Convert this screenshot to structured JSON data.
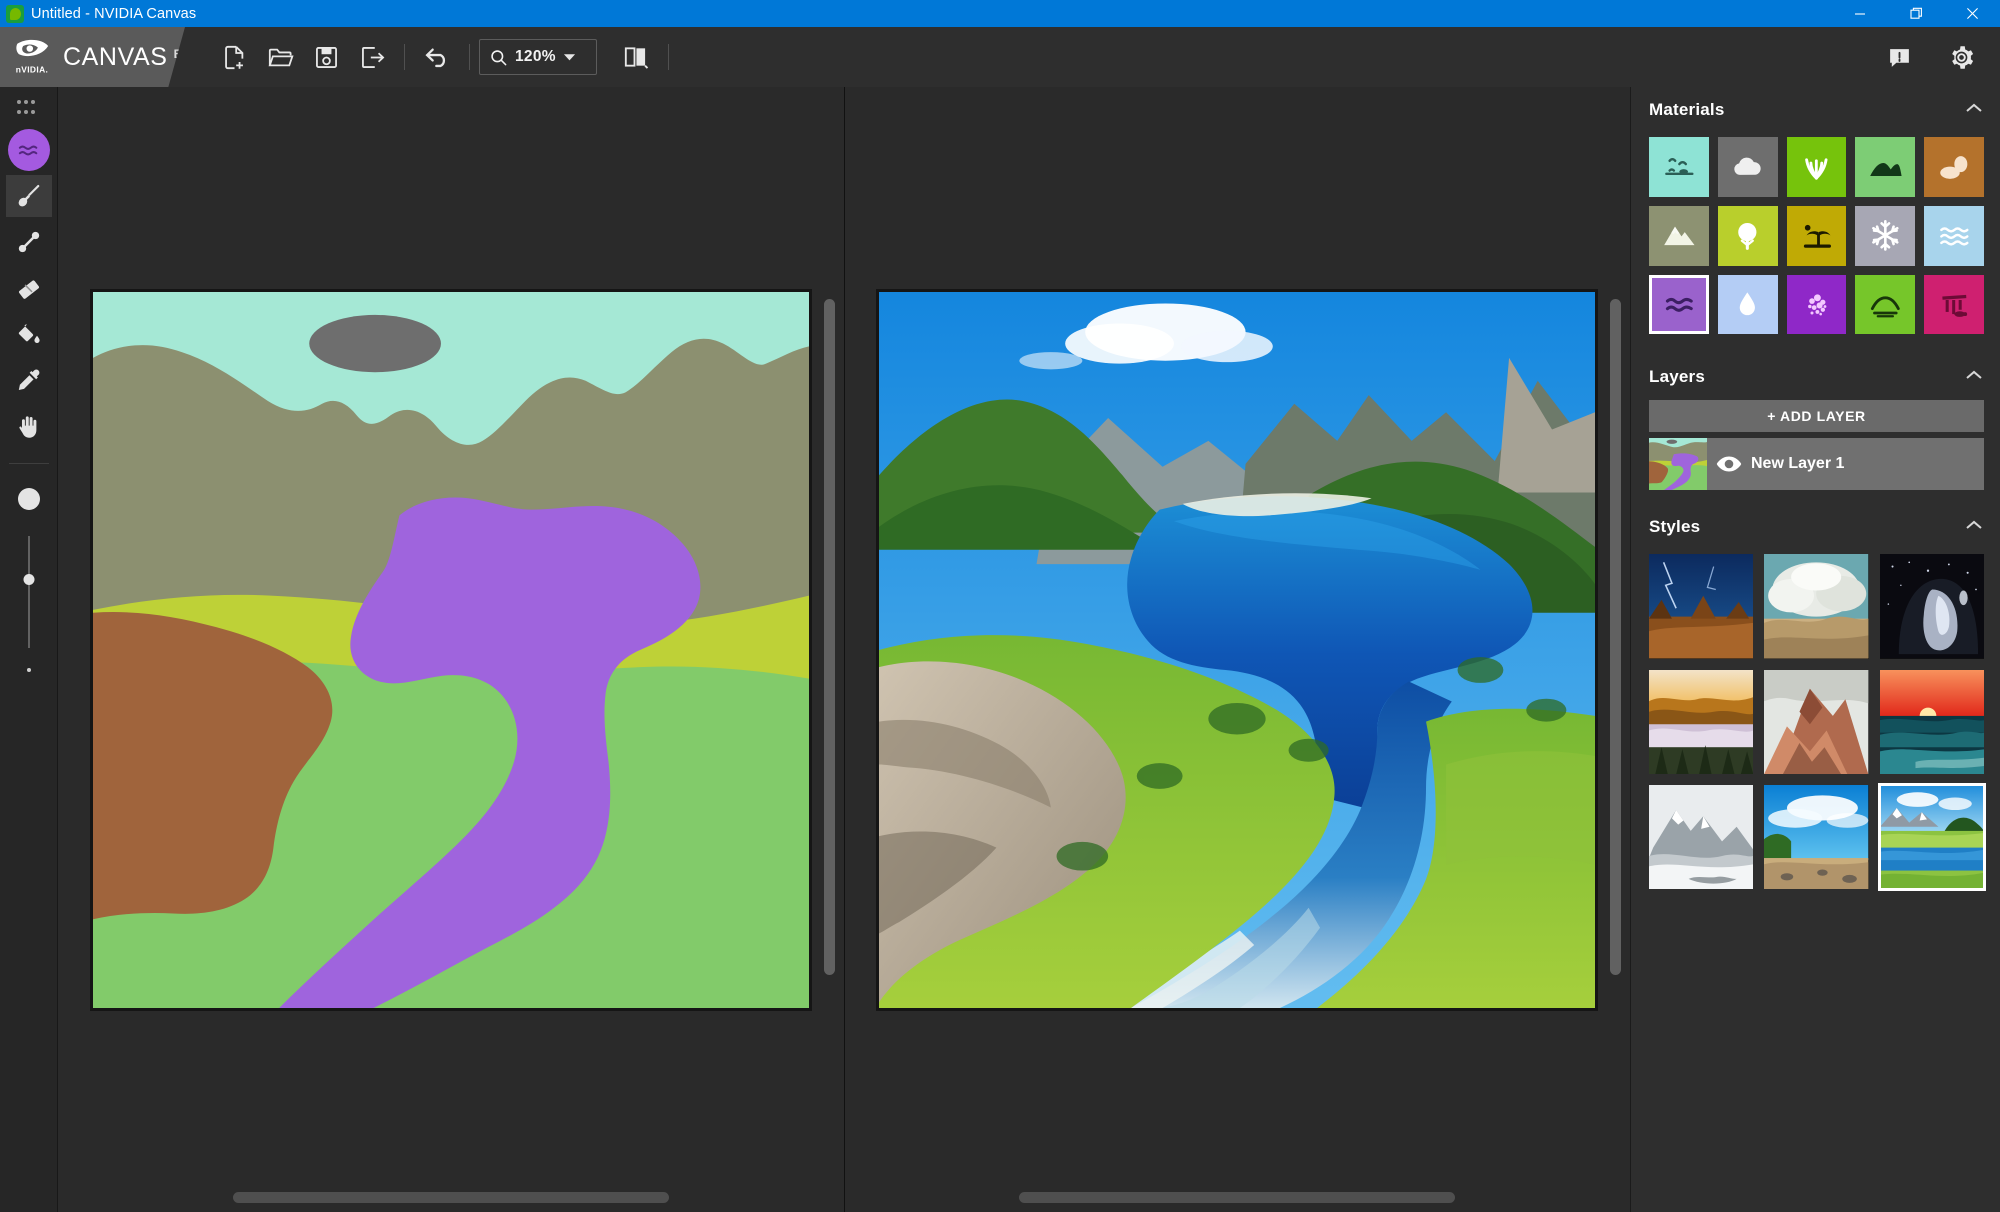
{
  "window": {
    "title": "Untitled - NVIDIA Canvas",
    "app_icon": "nvidia-canvas-app-icon",
    "controls": {
      "minimize": "minimize-window",
      "restore": "restore-window",
      "close": "close-window"
    }
  },
  "brand": {
    "logo": "nvidia-eye-logo",
    "name": "CANVAS",
    "tag": "BETA"
  },
  "toolbar": {
    "buttons": [
      {
        "name": "new-image",
        "icon": "new-document-icon",
        "label": "New"
      },
      {
        "name": "open-image",
        "icon": "folder-open-icon",
        "label": "Open"
      },
      {
        "name": "save-image",
        "icon": "save-disk-icon",
        "label": "Save"
      },
      {
        "name": "export-image",
        "icon": "export-arrow-icon",
        "label": "Export"
      },
      {
        "name": "undo",
        "icon": "undo-arrow-icon",
        "label": "Undo"
      }
    ],
    "zoom": {
      "value": "120%",
      "icon": "magnifier-icon",
      "caret": "chevron-down-icon"
    },
    "view_toggle": {
      "name": "split-view-toggle",
      "icon": "split-panel-icon"
    },
    "feedback": {
      "name": "feedback-button",
      "icon": "feedback-message-icon"
    },
    "settings": {
      "name": "settings-button",
      "icon": "gear-icon"
    }
  },
  "tools": {
    "grid_toggle": {
      "name": "tool-grid-toggle",
      "icon": "grid-dots-icon"
    },
    "active_material_swatch": {
      "name": "active-material-swatch",
      "icon": "water-waves-icon",
      "color": "#a45ae0"
    },
    "items": [
      {
        "name": "tool-paintbrush",
        "icon": "paintbrush-icon",
        "label": "Paint Brush",
        "active": true
      },
      {
        "name": "tool-line",
        "icon": "line-tool-icon",
        "label": "Line",
        "active": false
      },
      {
        "name": "tool-eraser",
        "icon": "eraser-icon",
        "label": "Eraser",
        "active": false
      },
      {
        "name": "tool-fill",
        "icon": "paint-bucket-icon",
        "label": "Fill",
        "active": false
      },
      {
        "name": "tool-eyedropper",
        "icon": "eyedropper-icon",
        "label": "Eyedropper",
        "active": false
      },
      {
        "name": "tool-pan",
        "icon": "hand-pan-icon",
        "label": "Pan",
        "active": false
      }
    ],
    "brush_size": {
      "name": "brush-size-slider",
      "preview_icon": "brush-size-circle"
    }
  },
  "canvas": {
    "segmentation_panel": {
      "name": "segmentation-canvas",
      "label": "Segmentation Map"
    },
    "render_panel": {
      "name": "rendered-canvas",
      "label": "Rendered Image"
    },
    "segmentation_colors": {
      "sky": "#a5e8d5",
      "cloud": "#6e6e6e",
      "mountain": "#8c9070",
      "grass_strip": "#bed137",
      "grass": "#82cb6a",
      "sand": "#a0643c",
      "water": "#9f64dd"
    }
  },
  "materials": {
    "title": "Materials",
    "collapse_icon": "chevron-up-icon",
    "items": [
      {
        "name": "material-sky",
        "label": "Sky",
        "color": "#8ee3d5",
        "icon": "birds-sky-icon",
        "fg": "#2b5f56",
        "selected": false
      },
      {
        "name": "material-cloud",
        "label": "Cloud",
        "color": "#6e6e6e",
        "icon": "cloud-icon",
        "fg": "#efefef",
        "selected": false
      },
      {
        "name": "material-grass",
        "label": "Grass",
        "color": "#76c30c",
        "icon": "grass-blades-icon",
        "fg": "#ffffff",
        "selected": false
      },
      {
        "name": "material-hill",
        "label": "Hill",
        "color": "#7dcd75",
        "icon": "hill-icon",
        "fg": "#123818",
        "selected": false
      },
      {
        "name": "material-sand",
        "label": "Sand",
        "color": "#b4722c",
        "icon": "rocks-sand-icon",
        "fg": "#f7e3cd",
        "selected": false
      },
      {
        "name": "material-mountain",
        "label": "Mountain",
        "color": "#8d9272",
        "icon": "mountain-icon",
        "fg": "#f2f4e6",
        "selected": false
      },
      {
        "name": "material-bush",
        "label": "Bush",
        "color": "#b9cf2c",
        "icon": "bush-icon",
        "fg": "#ffffff",
        "selected": false
      },
      {
        "name": "material-tree",
        "label": "Tree",
        "color": "#c0aa05",
        "icon": "palm-tree-icon",
        "fg": "#1c1a00",
        "selected": false
      },
      {
        "name": "material-snow",
        "label": "Snow",
        "color": "#a7a7b4",
        "icon": "snowflake-icon",
        "fg": "#ffffff",
        "selected": false
      },
      {
        "name": "material-sea",
        "label": "Sea",
        "color": "#a8d4ec",
        "icon": "sea-waves-icon",
        "fg": "#ffffff",
        "selected": false
      },
      {
        "name": "material-water",
        "label": "Water",
        "color": "#9a62cc",
        "icon": "water-waves-icon",
        "fg": "#3c1e63",
        "selected": true
      },
      {
        "name": "material-water-drop",
        "label": "Fog",
        "color": "#b4cdf5",
        "icon": "water-drop-icon",
        "fg": "#ffffff",
        "selected": false
      },
      {
        "name": "material-flower",
        "label": "Flower",
        "color": "#8f28c8",
        "icon": "flower-petals-icon",
        "fg": "#f3c8ff",
        "selected": false
      },
      {
        "name": "material-mud",
        "label": "Mud",
        "color": "#76c62a",
        "icon": "mud-mound-icon",
        "fg": "#18360a",
        "selected": false
      },
      {
        "name": "material-ruins",
        "label": "Ruins",
        "color": "#cf2070",
        "icon": "ruins-columns-icon",
        "fg": "#6d0b36",
        "selected": false
      }
    ]
  },
  "layers": {
    "title": "Layers",
    "collapse_icon": "chevron-up-icon",
    "add_button": "+ ADD LAYER",
    "items": [
      {
        "name": "layer-new-layer-1",
        "label": "New Layer 1",
        "visible": true,
        "visibility_icon": "eye-icon",
        "thumbnail": "layer-thumbnail"
      }
    ]
  },
  "styles": {
    "title": "Styles",
    "collapse_icon": "chevron-up-icon",
    "items": [
      {
        "name": "style-lightning-mesa",
        "label": "Lightning Mesa",
        "selected": false
      },
      {
        "name": "style-billowing-clouds",
        "label": "Billowing Clouds",
        "selected": false
      },
      {
        "name": "style-night-cave",
        "label": "Night Cave",
        "selected": false
      },
      {
        "name": "style-golden-fog",
        "label": "Golden Fog",
        "selected": false
      },
      {
        "name": "style-red-rock-peak",
        "label": "Red Rock Peak",
        "selected": false
      },
      {
        "name": "style-ocean-sunset",
        "label": "Ocean Sunset",
        "selected": false
      },
      {
        "name": "style-monochrome-peaks",
        "label": "Monochrome Peaks",
        "selected": false
      },
      {
        "name": "style-blue-sky-beach",
        "label": "Blue Sky Beach",
        "selected": false
      },
      {
        "name": "style-alpine-lake",
        "label": "Alpine Lake",
        "selected": true
      }
    ]
  }
}
